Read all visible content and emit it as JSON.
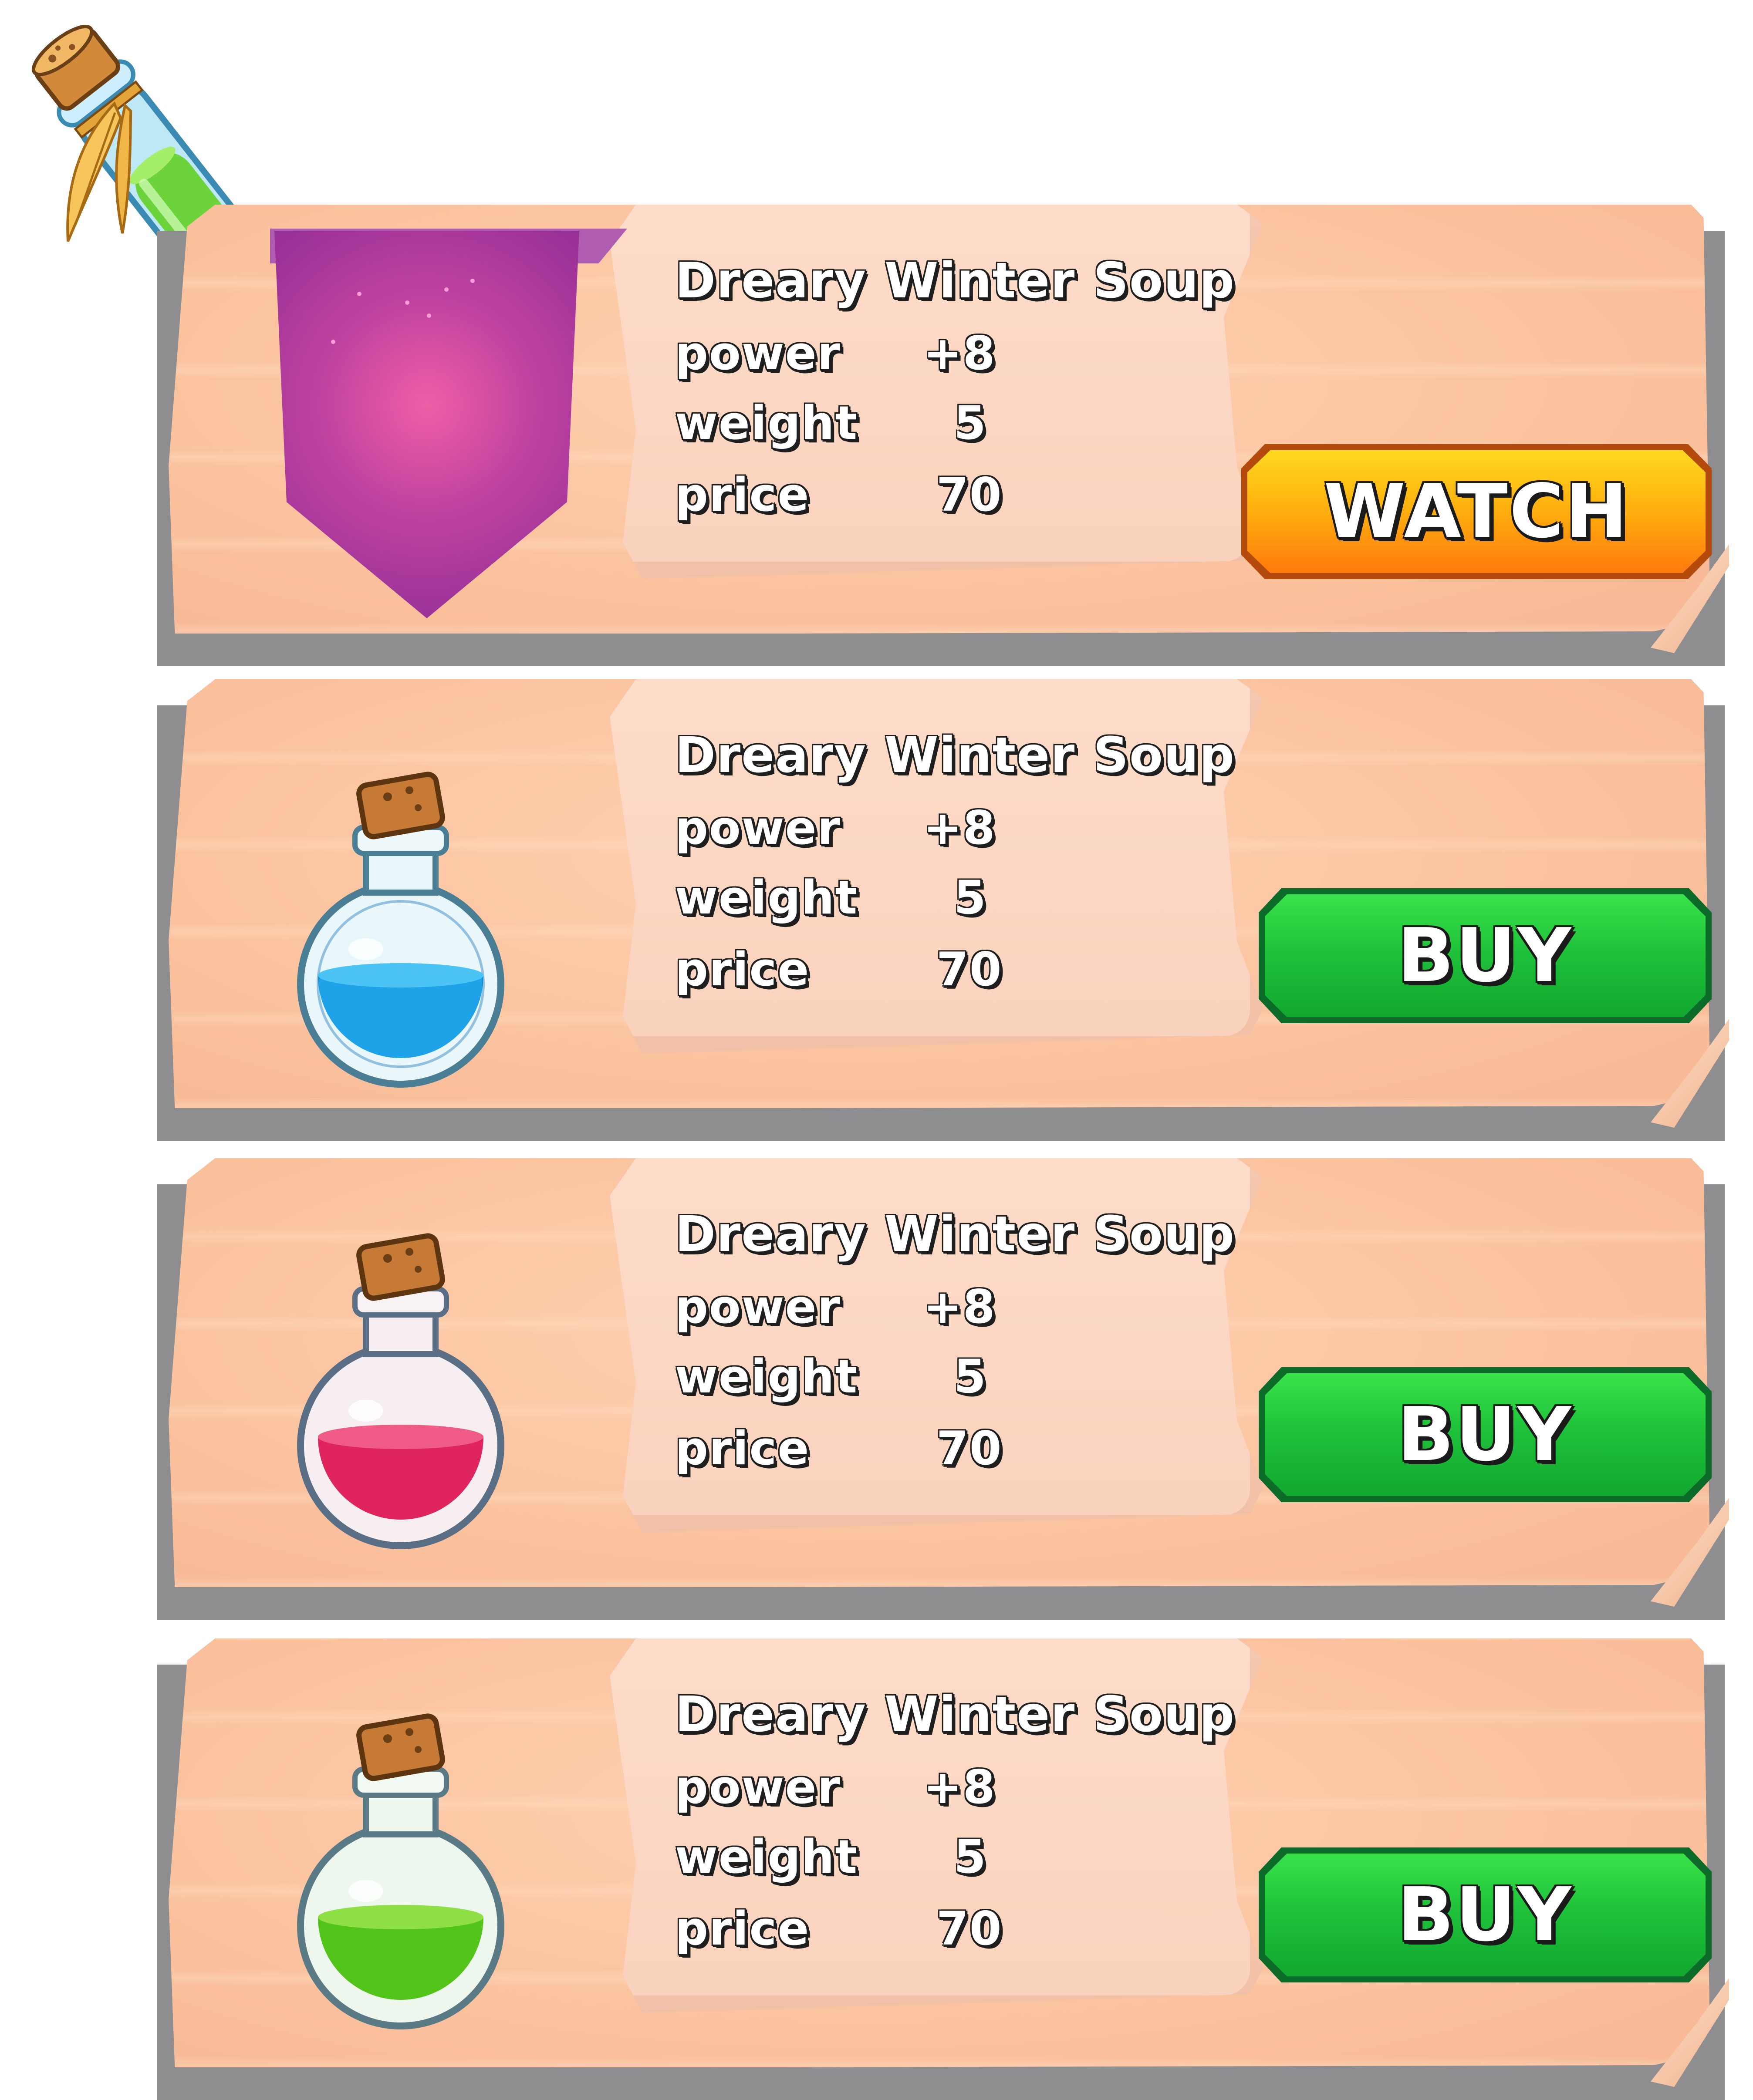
{
  "cards": [
    {
      "title": "Dreary Winter Soup",
      "stats": [
        {
          "label": "power",
          "value": "+8"
        },
        {
          "label": "weight",
          "value": "5"
        },
        {
          "label": "price",
          "value": "70"
        }
      ],
      "button": "WATCH",
      "icon": "purple-ribbon-banner-icon"
    },
    {
      "title": "Dreary Winter Soup",
      "stats": [
        {
          "label": "power",
          "value": "+8"
        },
        {
          "label": "weight",
          "value": "5"
        },
        {
          "label": "price",
          "value": "70"
        }
      ],
      "button": "BUY",
      "icon": "blue-potion-flask-icon",
      "liquid_color": "#1ea3e8"
    },
    {
      "title": "Dreary Winter Soup",
      "stats": [
        {
          "label": "power",
          "value": "+8"
        },
        {
          "label": "weight",
          "value": "5"
        },
        {
          "label": "price",
          "value": "70"
        }
      ],
      "button": "BUY",
      "icon": "red-potion-flask-icon",
      "liquid_color": "#e0245e"
    },
    {
      "title": "Dreary Winter Soup",
      "stats": [
        {
          "label": "power",
          "value": "+8"
        },
        {
          "label": "weight",
          "value": "5"
        },
        {
          "label": "price",
          "value": "70"
        }
      ],
      "button": "BUY",
      "icon": "green-potion-flask-icon",
      "liquid_color": "#52c41a"
    }
  ],
  "decor": {
    "icon": "green-test-tube-potion-icon"
  },
  "colors": {
    "board": "#fbc39f",
    "board_shadow": "#8e8e90",
    "scroll": "#fddcc9",
    "watch_button": "#ff9a14",
    "buy_button": "#22c43b",
    "ribbon": "#9c2f97"
  }
}
